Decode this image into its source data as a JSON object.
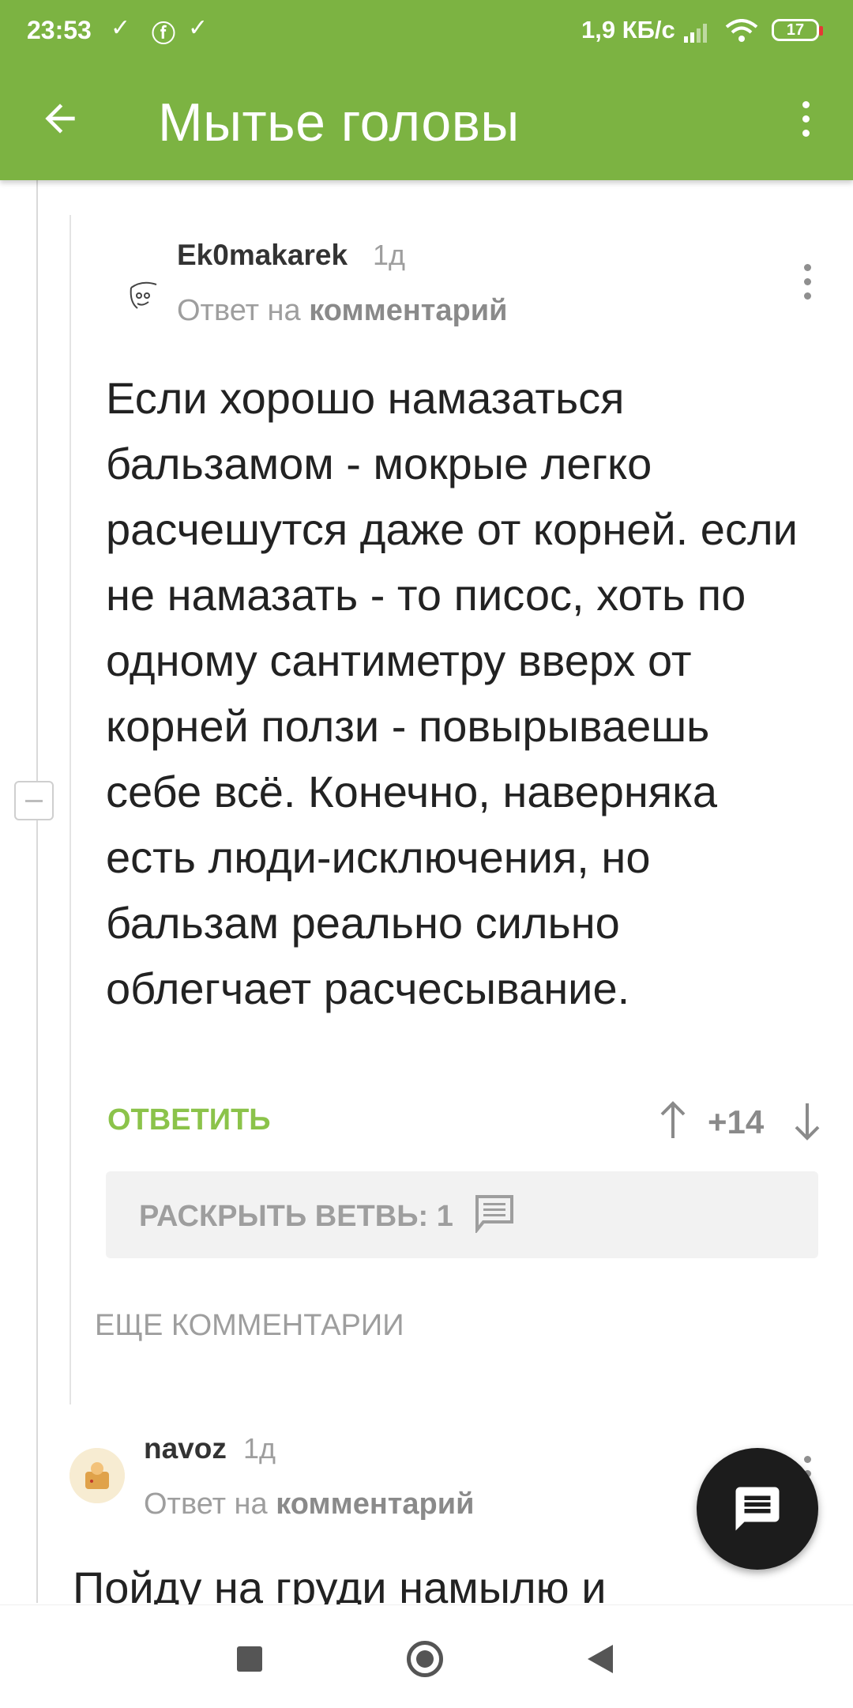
{
  "status_bar": {
    "time": "23:53",
    "speed": "1,9 КБ/с",
    "battery": "17"
  },
  "header": {
    "title": "Мытье головы"
  },
  "comment1": {
    "username": "Ek0makarek",
    "age": "1д",
    "reply_prefix": "Ответ на",
    "reply_link": "комментарий",
    "text": "Если хорошо намазаться бальзамом - мокрые легко расчешутся даже от корней. если не намазать - то писос, хоть по одному сантиметру вверх от корней ползи - повырываешь себе всё. Конечно, наверняка есть люди-исключения, но бальзам реально сильно облегчает расчесывание.",
    "reply_label": "ОТВЕТИТЬ",
    "score": "+14"
  },
  "expand_branch": {
    "label": "РАСКРЫТЬ ВЕТВЬ: 1"
  },
  "more_comments": "ЕЩЕ КОММЕНТАРИИ",
  "comment2": {
    "username": "navoz",
    "age": "1д",
    "reply_prefix": "Ответ на",
    "reply_link": "комментарий",
    "text": "Пойду на груди намылю и"
  },
  "icons": {
    "back": "arrow-left-icon",
    "menu": "more-vert-icon",
    "fab": "comment-icon",
    "vote_up": "arrow-up-icon",
    "vote_down": "arrow-down-icon"
  },
  "colors": {
    "accent": "#7cb342",
    "reply": "#8bc34a",
    "fab": "#1c1c1c"
  }
}
